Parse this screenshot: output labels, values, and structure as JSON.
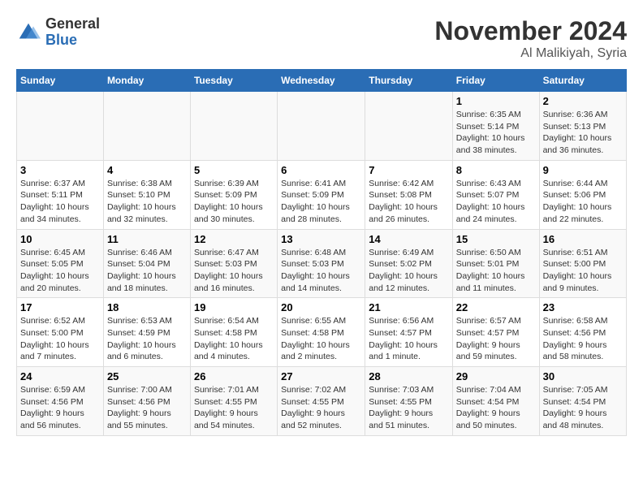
{
  "logo": {
    "general": "General",
    "blue": "Blue"
  },
  "title": "November 2024",
  "subtitle": "Al Malikiyah, Syria",
  "headers": [
    "Sunday",
    "Monday",
    "Tuesday",
    "Wednesday",
    "Thursday",
    "Friday",
    "Saturday"
  ],
  "weeks": [
    [
      {
        "day": "",
        "info": ""
      },
      {
        "day": "",
        "info": ""
      },
      {
        "day": "",
        "info": ""
      },
      {
        "day": "",
        "info": ""
      },
      {
        "day": "",
        "info": ""
      },
      {
        "day": "1",
        "info": "Sunrise: 6:35 AM\nSunset: 5:14 PM\nDaylight: 10 hours and 38 minutes."
      },
      {
        "day": "2",
        "info": "Sunrise: 6:36 AM\nSunset: 5:13 PM\nDaylight: 10 hours and 36 minutes."
      }
    ],
    [
      {
        "day": "3",
        "info": "Sunrise: 6:37 AM\nSunset: 5:11 PM\nDaylight: 10 hours and 34 minutes."
      },
      {
        "day": "4",
        "info": "Sunrise: 6:38 AM\nSunset: 5:10 PM\nDaylight: 10 hours and 32 minutes."
      },
      {
        "day": "5",
        "info": "Sunrise: 6:39 AM\nSunset: 5:09 PM\nDaylight: 10 hours and 30 minutes."
      },
      {
        "day": "6",
        "info": "Sunrise: 6:41 AM\nSunset: 5:09 PM\nDaylight: 10 hours and 28 minutes."
      },
      {
        "day": "7",
        "info": "Sunrise: 6:42 AM\nSunset: 5:08 PM\nDaylight: 10 hours and 26 minutes."
      },
      {
        "day": "8",
        "info": "Sunrise: 6:43 AM\nSunset: 5:07 PM\nDaylight: 10 hours and 24 minutes."
      },
      {
        "day": "9",
        "info": "Sunrise: 6:44 AM\nSunset: 5:06 PM\nDaylight: 10 hours and 22 minutes."
      }
    ],
    [
      {
        "day": "10",
        "info": "Sunrise: 6:45 AM\nSunset: 5:05 PM\nDaylight: 10 hours and 20 minutes."
      },
      {
        "day": "11",
        "info": "Sunrise: 6:46 AM\nSunset: 5:04 PM\nDaylight: 10 hours and 18 minutes."
      },
      {
        "day": "12",
        "info": "Sunrise: 6:47 AM\nSunset: 5:03 PM\nDaylight: 10 hours and 16 minutes."
      },
      {
        "day": "13",
        "info": "Sunrise: 6:48 AM\nSunset: 5:03 PM\nDaylight: 10 hours and 14 minutes."
      },
      {
        "day": "14",
        "info": "Sunrise: 6:49 AM\nSunset: 5:02 PM\nDaylight: 10 hours and 12 minutes."
      },
      {
        "day": "15",
        "info": "Sunrise: 6:50 AM\nSunset: 5:01 PM\nDaylight: 10 hours and 11 minutes."
      },
      {
        "day": "16",
        "info": "Sunrise: 6:51 AM\nSunset: 5:00 PM\nDaylight: 10 hours and 9 minutes."
      }
    ],
    [
      {
        "day": "17",
        "info": "Sunrise: 6:52 AM\nSunset: 5:00 PM\nDaylight: 10 hours and 7 minutes."
      },
      {
        "day": "18",
        "info": "Sunrise: 6:53 AM\nSunset: 4:59 PM\nDaylight: 10 hours and 6 minutes."
      },
      {
        "day": "19",
        "info": "Sunrise: 6:54 AM\nSunset: 4:58 PM\nDaylight: 10 hours and 4 minutes."
      },
      {
        "day": "20",
        "info": "Sunrise: 6:55 AM\nSunset: 4:58 PM\nDaylight: 10 hours and 2 minutes."
      },
      {
        "day": "21",
        "info": "Sunrise: 6:56 AM\nSunset: 4:57 PM\nDaylight: 10 hours and 1 minute."
      },
      {
        "day": "22",
        "info": "Sunrise: 6:57 AM\nSunset: 4:57 PM\nDaylight: 9 hours and 59 minutes."
      },
      {
        "day": "23",
        "info": "Sunrise: 6:58 AM\nSunset: 4:56 PM\nDaylight: 9 hours and 58 minutes."
      }
    ],
    [
      {
        "day": "24",
        "info": "Sunrise: 6:59 AM\nSunset: 4:56 PM\nDaylight: 9 hours and 56 minutes."
      },
      {
        "day": "25",
        "info": "Sunrise: 7:00 AM\nSunset: 4:56 PM\nDaylight: 9 hours and 55 minutes."
      },
      {
        "day": "26",
        "info": "Sunrise: 7:01 AM\nSunset: 4:55 PM\nDaylight: 9 hours and 54 minutes."
      },
      {
        "day": "27",
        "info": "Sunrise: 7:02 AM\nSunset: 4:55 PM\nDaylight: 9 hours and 52 minutes."
      },
      {
        "day": "28",
        "info": "Sunrise: 7:03 AM\nSunset: 4:55 PM\nDaylight: 9 hours and 51 minutes."
      },
      {
        "day": "29",
        "info": "Sunrise: 7:04 AM\nSunset: 4:54 PM\nDaylight: 9 hours and 50 minutes."
      },
      {
        "day": "30",
        "info": "Sunrise: 7:05 AM\nSunset: 4:54 PM\nDaylight: 9 hours and 48 minutes."
      }
    ]
  ]
}
